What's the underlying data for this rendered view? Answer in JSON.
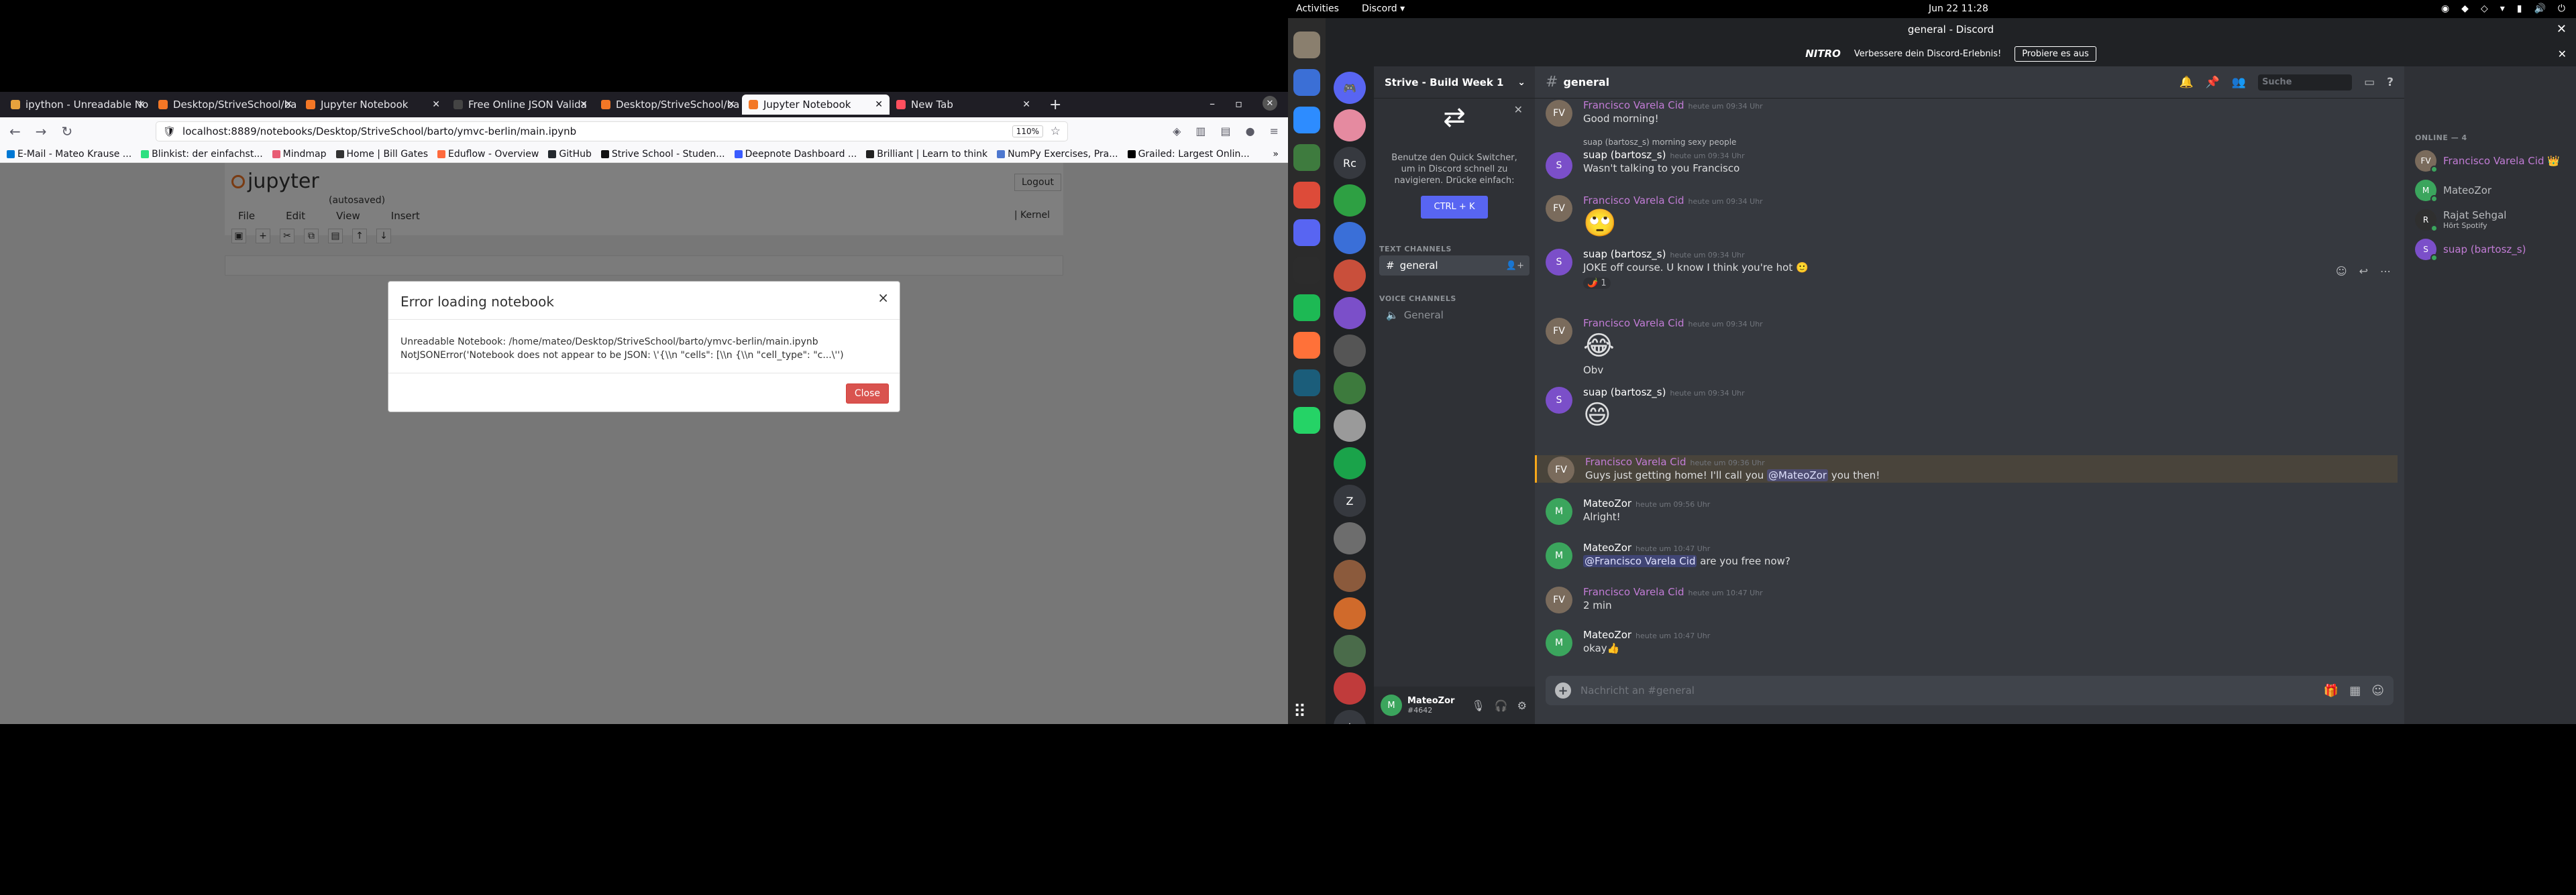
{
  "firefox": {
    "tabs": [
      {
        "label": "ipython - Unreadable No",
        "icon_color": "#e8a33d",
        "active": false
      },
      {
        "label": "Desktop/StriveSchool/ba",
        "icon_color": "#f37726",
        "active": false
      },
      {
        "label": "Jupyter Notebook",
        "icon_color": "#f37726",
        "active": false
      },
      {
        "label": "Free Online JSON Valida",
        "icon_color": "#444444",
        "active": false
      },
      {
        "label": "Desktop/StriveSchool/ba",
        "icon_color": "#f37726",
        "active": false
      },
      {
        "label": "Jupyter Notebook",
        "icon_color": "#f37726",
        "active": true
      },
      {
        "label": "New Tab",
        "icon_color": "#ff4f5e",
        "active": false
      }
    ],
    "url": "localhost:8889/notebooks/Desktop/StriveSchool/barto/ymvc-berlin/main.ipynb",
    "zoom": "110%",
    "bookmarks": [
      {
        "label": "E-Mail - Mateo Krause ...",
        "color": "#0078d4"
      },
      {
        "label": "Blinkist: der einfachst...",
        "color": "#2ce080"
      },
      {
        "label": "Mindmap",
        "color": "#e85d75"
      },
      {
        "label": "Home | Bill Gates",
        "color": "#333333"
      },
      {
        "label": "Eduflow - Overview",
        "color": "#ff6a3d"
      },
      {
        "label": "GitHub",
        "color": "#24292e"
      },
      {
        "label": "Strive School - Studen...",
        "color": "#111111"
      },
      {
        "label": "Deepnote Dashboard ...",
        "color": "#3b5cff"
      },
      {
        "label": "Brilliant | Learn to think",
        "color": "#222222"
      },
      {
        "label": "NumPy Exercises, Pra...",
        "color": "#4d77cf"
      },
      {
        "label": "Grailed: Largest Onlin...",
        "color": "#000000"
      }
    ]
  },
  "jupyter": {
    "logo": "jupyter",
    "autosaved": "(autosaved)",
    "logout": "Logout",
    "menu": [
      "File",
      "Edit",
      "View",
      "Insert"
    ],
    "kernel": "| Kernel"
  },
  "modal": {
    "title": "Error loading notebook",
    "close_x": "×",
    "body": "Unreadable Notebook: /home/mateo/Desktop/StriveSchool/barto/ymvc-berlin/main.ipynb NotJSONError('Notebook does not appear to be JSON: \\'{\\\\n \"cells\": [\\\\n {\\\\n \"cell_type\": \"c...\\'')",
    "button": "Close"
  },
  "system": {
    "activities": "Activities",
    "app": "Discord ▾",
    "clock": "Jun 22  11:28"
  },
  "discord": {
    "window_title": "general - Discord",
    "nitro": {
      "logo": "NITRO",
      "text": "Verbessere dein Discord-Erlebnis!",
      "button": "Probiere es aus"
    },
    "server_name": "Strive - Build Week 1",
    "quick_switcher": {
      "text": "Benutze den Quick Switcher, um in Discord schnell zu navigieren. Drücke einfach:",
      "button": "CTRL + K"
    },
    "text_channels_label": "TEXT CHANNELS",
    "voice_channels_label": "VOICE CHANNELS",
    "text_channel": "general",
    "voice_channel": "General",
    "user": {
      "name": "MateoZor",
      "tag": "#4642"
    },
    "channel_header": "general",
    "search_placeholder": "Suche",
    "composer_placeholder": "Nachricht an #general",
    "messages": [
      {
        "author": "Francisco Varela Cid",
        "color": "#c27cd6",
        "time": "heute um 09:34 Uhr",
        "text": "Good morning!",
        "avatar": "FV",
        "avatar_color": "#7a6b5c"
      },
      {
        "author": "suap (bartosz_s)",
        "color": "#ffffff",
        "time": "heute um 09:34 Uhr",
        "text": "Wasn't talking to you Francisco",
        "avatar": "S",
        "avatar_color": "#7b4fc9",
        "reply": "suap (bartosz_s)  morning sexy people"
      },
      {
        "author": "Francisco Varela Cid",
        "color": "#c27cd6",
        "time": "heute um 09:34 Uhr",
        "text": "🙄",
        "emoji": true,
        "avatar": "FV",
        "avatar_color": "#7a6b5c"
      },
      {
        "author": "suap (bartosz_s)",
        "color": "#ffffff",
        "time": "heute um 09:34 Uhr",
        "text": "JOKE off course. U know I think you're hot 🙂",
        "avatar": "S",
        "avatar_color": "#7b4fc9",
        "reaction": "🌶️ 1"
      },
      {
        "author": "Francisco Varela Cid",
        "color": "#c27cd6",
        "time": "heute um 09:34 Uhr",
        "text": "😂",
        "emoji": true,
        "extra": "Obv",
        "avatar": "FV",
        "avatar_color": "#7a6b5c"
      },
      {
        "author": "suap (bartosz_s)",
        "color": "#ffffff",
        "time": "heute um 09:34 Uhr",
        "text": "😄",
        "emoji": true,
        "avatar": "S",
        "avatar_color": "#7b4fc9"
      },
      {
        "author": "Francisco Varela Cid",
        "color": "#c27cd6",
        "time": "heute um 09:36 Uhr",
        "text_before": "Guys just getting home! I'll call you ",
        "mention": "@MateoZor",
        "text_after": " you then!",
        "highlight": true,
        "avatar": "FV",
        "avatar_color": "#7a6b5c"
      },
      {
        "author": "MateoZor",
        "color": "#ffffff",
        "time": "heute um 09:56 Uhr",
        "text": "Alright!",
        "avatar": "M",
        "avatar_color": "#3ba55d"
      },
      {
        "author": "MateoZor",
        "color": "#ffffff",
        "time": "heute um 10:47 Uhr",
        "mention": "@Francisco Varela Cid",
        "text_after": " are you free now?",
        "text_before": "",
        "avatar": "M",
        "avatar_color": "#3ba55d"
      },
      {
        "author": "Francisco Varela Cid",
        "color": "#c27cd6",
        "time": "heute um 10:47 Uhr",
        "text": "2 min",
        "avatar": "FV",
        "avatar_color": "#7a6b5c"
      },
      {
        "author": "MateoZor",
        "color": "#ffffff",
        "time": "heute um 10:47 Uhr",
        "text": "okay👍",
        "avatar": "M",
        "avatar_color": "#3ba55d"
      }
    ],
    "members_header": "ONLINE — 4",
    "members": [
      {
        "name": "Francisco Varela Cid 👑",
        "color": "#c27cd6",
        "avatar": "FV",
        "avatar_color": "#7a6b5c",
        "status": ""
      },
      {
        "name": "MateoZor",
        "color": "#b9bbbe",
        "avatar": "M",
        "avatar_color": "#3ba55d",
        "status": ""
      },
      {
        "name": "Rajat Sehgal",
        "color": "#b9bbbe",
        "avatar": "R",
        "avatar_color": "#2f2f2f",
        "status": "Hört Spotify"
      },
      {
        "name": "suap (bartosz_s)",
        "color": "#c27cd6",
        "avatar": "S",
        "avatar_color": "#7b4fc9",
        "status": ""
      }
    ],
    "guilds": [
      {
        "label": "🎮",
        "color": "#5865f2"
      },
      {
        "label": "",
        "color": "#e58aa0"
      },
      {
        "label": "Rc",
        "color": "#36393f"
      },
      {
        "label": "",
        "color": "#2ea043"
      },
      {
        "label": "",
        "color": "#3a6fd8"
      },
      {
        "label": "",
        "color": "#c94f3b"
      },
      {
        "label": "",
        "color": "#7b4fc9"
      },
      {
        "label": "",
        "color": "#555555"
      },
      {
        "label": "",
        "color": "#3d7a3d"
      },
      {
        "label": "",
        "color": "#9a9a9a"
      },
      {
        "label": "",
        "color": "#1aa34a"
      },
      {
        "label": "Z",
        "color": "#36393f"
      },
      {
        "label": "",
        "color": "#6d6d6d"
      },
      {
        "label": "",
        "color": "#8b5a3c"
      },
      {
        "label": "",
        "color": "#d06a2b"
      },
      {
        "label": "",
        "color": "#4a6b4a"
      },
      {
        "label": "",
        "color": "#c03b3b"
      },
      {
        "label": "+",
        "color": "#36393f"
      }
    ]
  },
  "dock": [
    {
      "name": "files",
      "color": "#8a7f6e"
    },
    {
      "name": "screenshot",
      "color": "#3b6fd6"
    },
    {
      "name": "zoom",
      "color": "#2d8cff"
    },
    {
      "name": "recycle",
      "color": "#3e7b3e"
    },
    {
      "name": "chrome",
      "color": "#dd4b39"
    },
    {
      "name": "discord",
      "color": "#5865f2"
    },
    {
      "name": "terminal",
      "color": "#2c2c2c"
    },
    {
      "name": "spotify",
      "color": "#1db954"
    },
    {
      "name": "firefox",
      "color": "#ff7139"
    },
    {
      "name": "pycharm",
      "color": "#1b5d7a"
    },
    {
      "name": "whatsapp",
      "color": "#25d366"
    }
  ]
}
